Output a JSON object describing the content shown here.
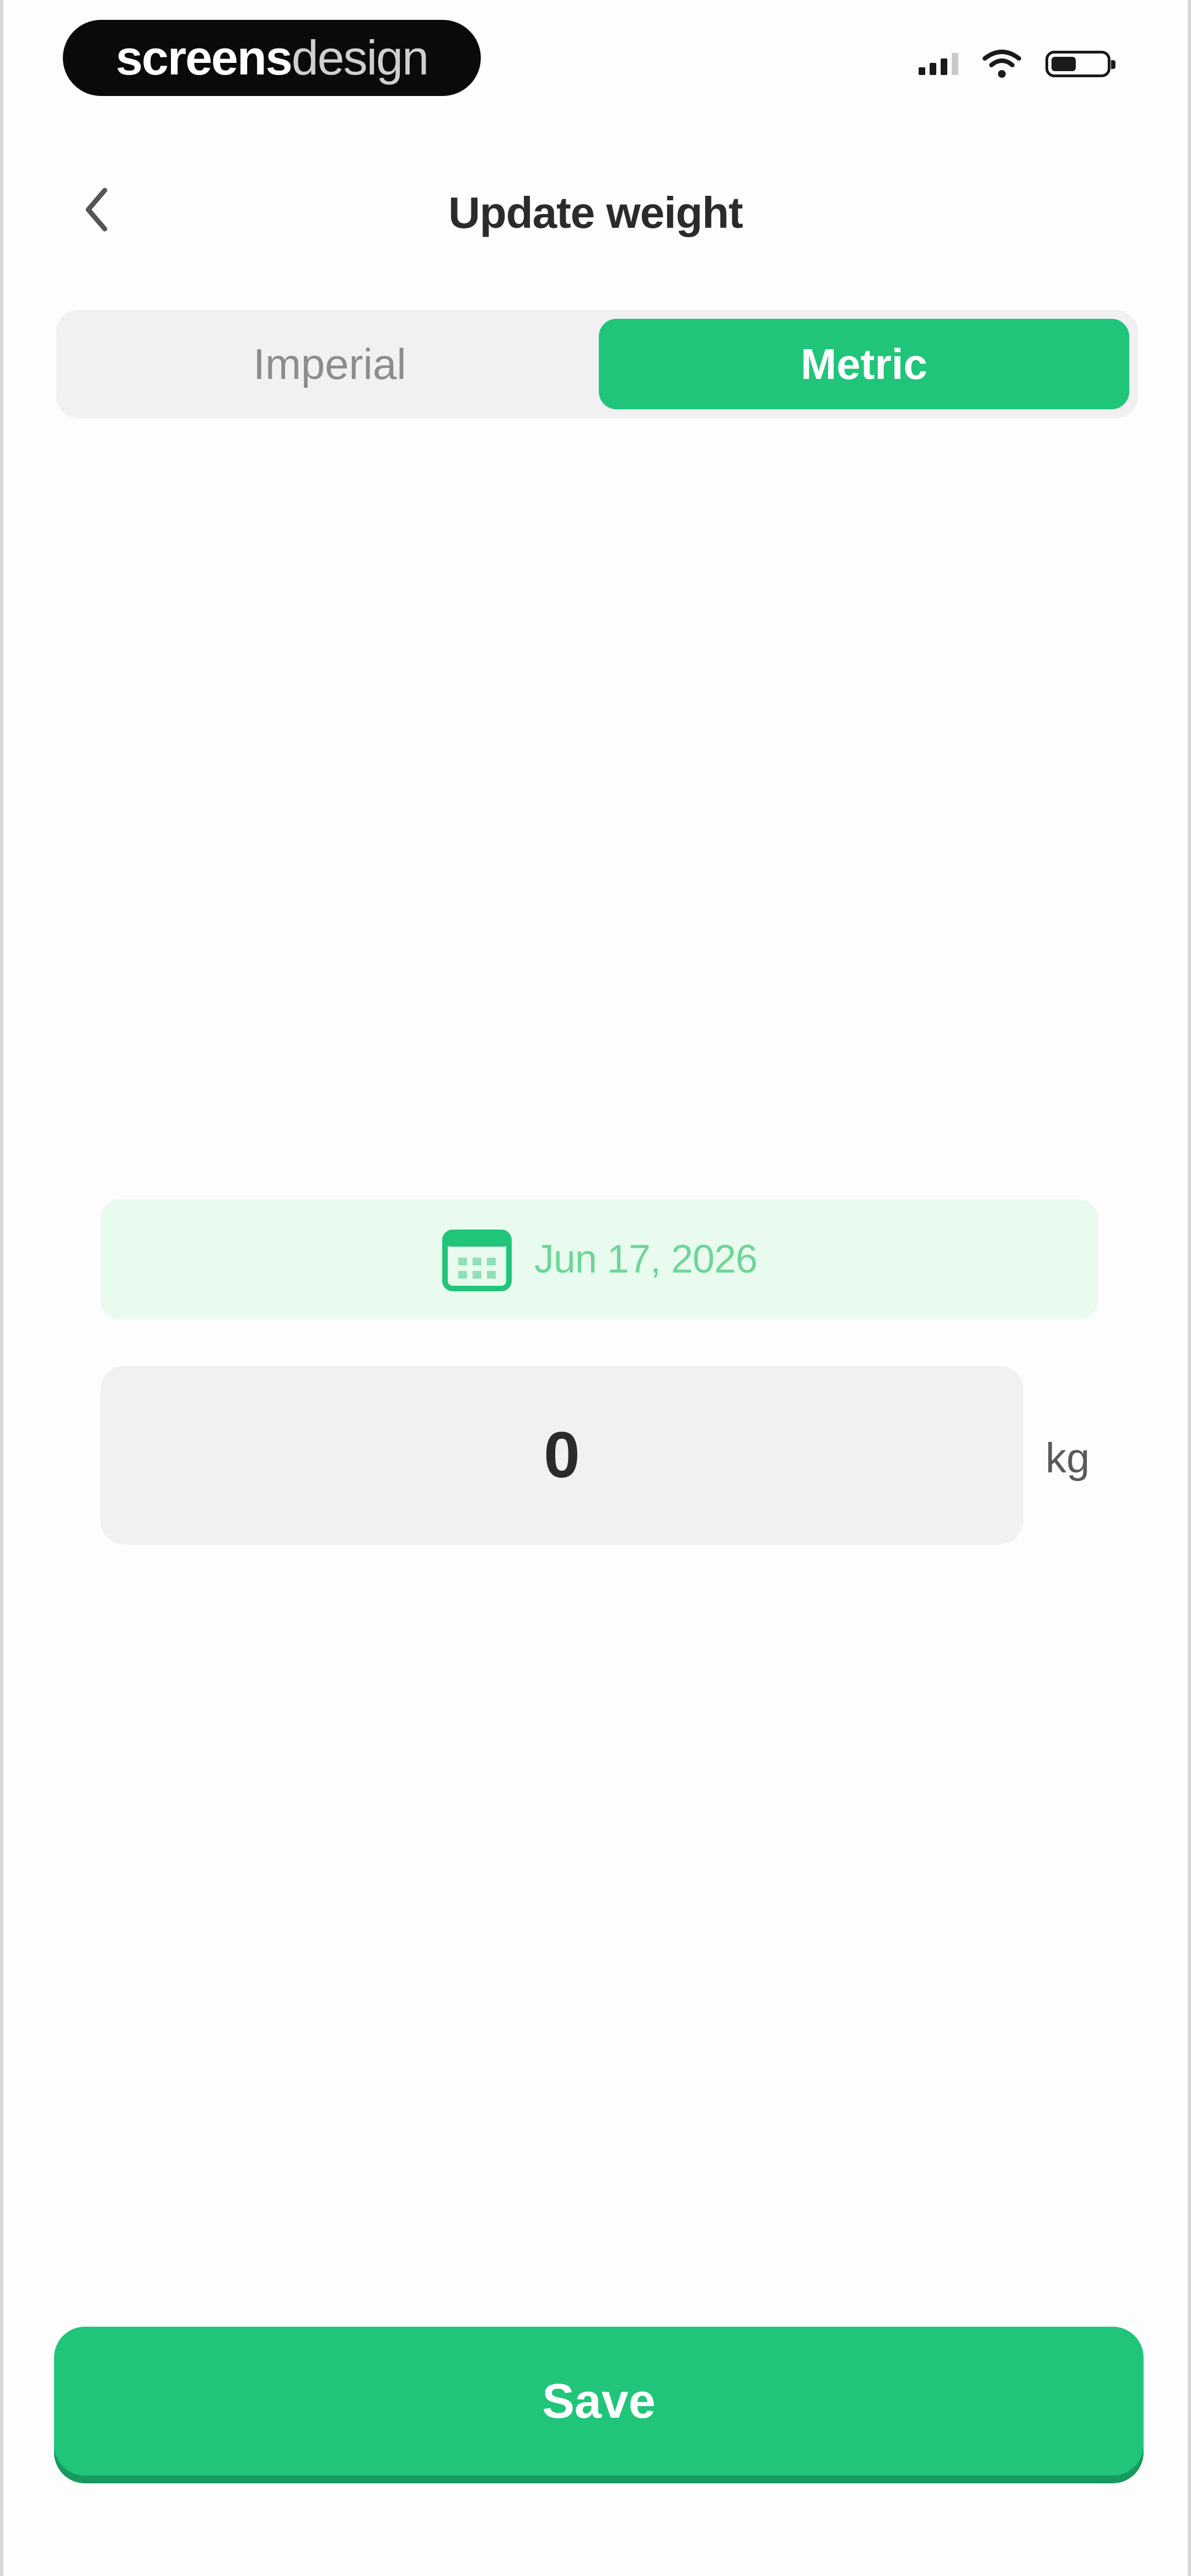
{
  "status_bar": {
    "brand_part1": "screens",
    "brand_part2": "design",
    "signal_icon": "cellular-signal-icon",
    "wifi_icon": "wifi-icon",
    "battery_icon": "battery-icon"
  },
  "header": {
    "back_icon": "chevron-left-icon",
    "title": "Update weight"
  },
  "unit_toggle": {
    "options": [
      {
        "label": "Imperial",
        "selected": false
      },
      {
        "label": "Metric",
        "selected": true
      }
    ]
  },
  "date_picker": {
    "icon": "calendar-icon",
    "value": "Jun 17, 2026"
  },
  "weight": {
    "value": "0",
    "unit": "kg"
  },
  "actions": {
    "save_label": "Save"
  },
  "colors": {
    "accent": "#20c57a",
    "accent_light": "#e9fbef",
    "field_bg": "#f1f1f3",
    "text_primary": "#2b2b2b"
  }
}
